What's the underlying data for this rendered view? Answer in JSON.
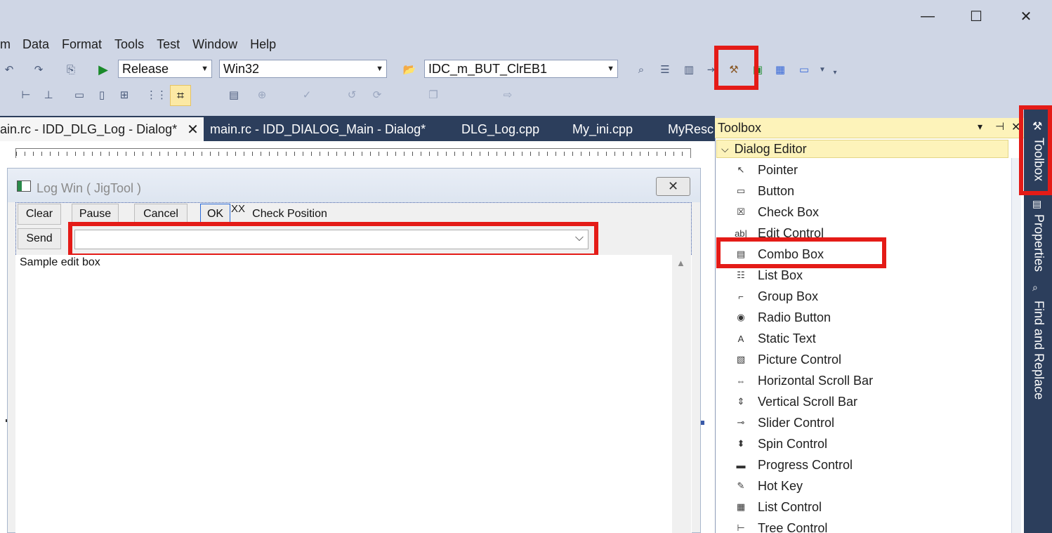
{
  "window": {
    "minimize_glyph": "—",
    "maximize_glyph": "☐",
    "close_glyph": "✕"
  },
  "menu": {
    "items": [
      "m",
      "Data",
      "Format",
      "Tools",
      "Test",
      "Window",
      "Help"
    ]
  },
  "toolbar": {
    "config": "Release",
    "platform": "Win32",
    "resource_id": "IDC_m_BUT_ClrEB1",
    "icons": [
      "undo-icon",
      "redo-icon",
      "play-icon",
      "open-folder-icon",
      "browse-icon",
      "properties-icon",
      "class-view-icon",
      "toolbox-icon",
      "run-icon",
      "resource-icon",
      "terminal-icon",
      "overflow-icon"
    ]
  },
  "tabs": [
    {
      "label": "ain.rc - IDD_DLG_Log - Dialog*",
      "active": true,
      "close": "✕"
    },
    {
      "label": "main.rc - IDD_DIALOG_Main - Dialog*"
    },
    {
      "label": "DLG_Log.cpp"
    },
    {
      "label": "My_ini.cpp"
    },
    {
      "label": "MyResc"
    }
  ],
  "dialog": {
    "caption": "Log Win ( JigTool )",
    "close_glyph": "✕",
    "buttons": {
      "clear": "Clear",
      "pause": "Pause",
      "cancel": "Cancel",
      "ok": "OK",
      "send": "Send"
    },
    "xx_label": "XX",
    "check_position": "Check Position",
    "edit_text": "Sample edit box",
    "combo_arrow": "⌵"
  },
  "toolbox": {
    "title": "Toolbox",
    "header_glyphs": {
      "dropdown": "▾",
      "pin": "⊣",
      "close": "✕"
    },
    "group": "Dialog Editor",
    "items": [
      {
        "label": "Pointer",
        "icon": "↖"
      },
      {
        "label": "Button",
        "icon": "▭"
      },
      {
        "label": "Check Box",
        "icon": "☒"
      },
      {
        "label": "Edit Control",
        "icon": "ab|"
      },
      {
        "label": "Combo Box",
        "icon": "▤"
      },
      {
        "label": "List Box",
        "icon": "☷"
      },
      {
        "label": "Group Box",
        "icon": "⌐"
      },
      {
        "label": "Radio Button",
        "icon": "◉"
      },
      {
        "label": "Static Text",
        "icon": "A"
      },
      {
        "label": "Picture Control",
        "icon": "▧"
      },
      {
        "label": "Horizontal Scroll Bar",
        "icon": "⇔"
      },
      {
        "label": "Vertical Scroll Bar",
        "icon": "⇕"
      },
      {
        "label": "Slider Control",
        "icon": "⊸"
      },
      {
        "label": "Spin Control",
        "icon": "⬍"
      },
      {
        "label": "Progress Control",
        "icon": "▬"
      },
      {
        "label": "Hot Key",
        "icon": "✎"
      },
      {
        "label": "List Control",
        "icon": "▦"
      },
      {
        "label": "Tree Control",
        "icon": "⊢"
      }
    ]
  },
  "side_tabs": [
    "Toolbox",
    "Properties",
    "Find and Replace"
  ],
  "accent_red": "#e41b17"
}
